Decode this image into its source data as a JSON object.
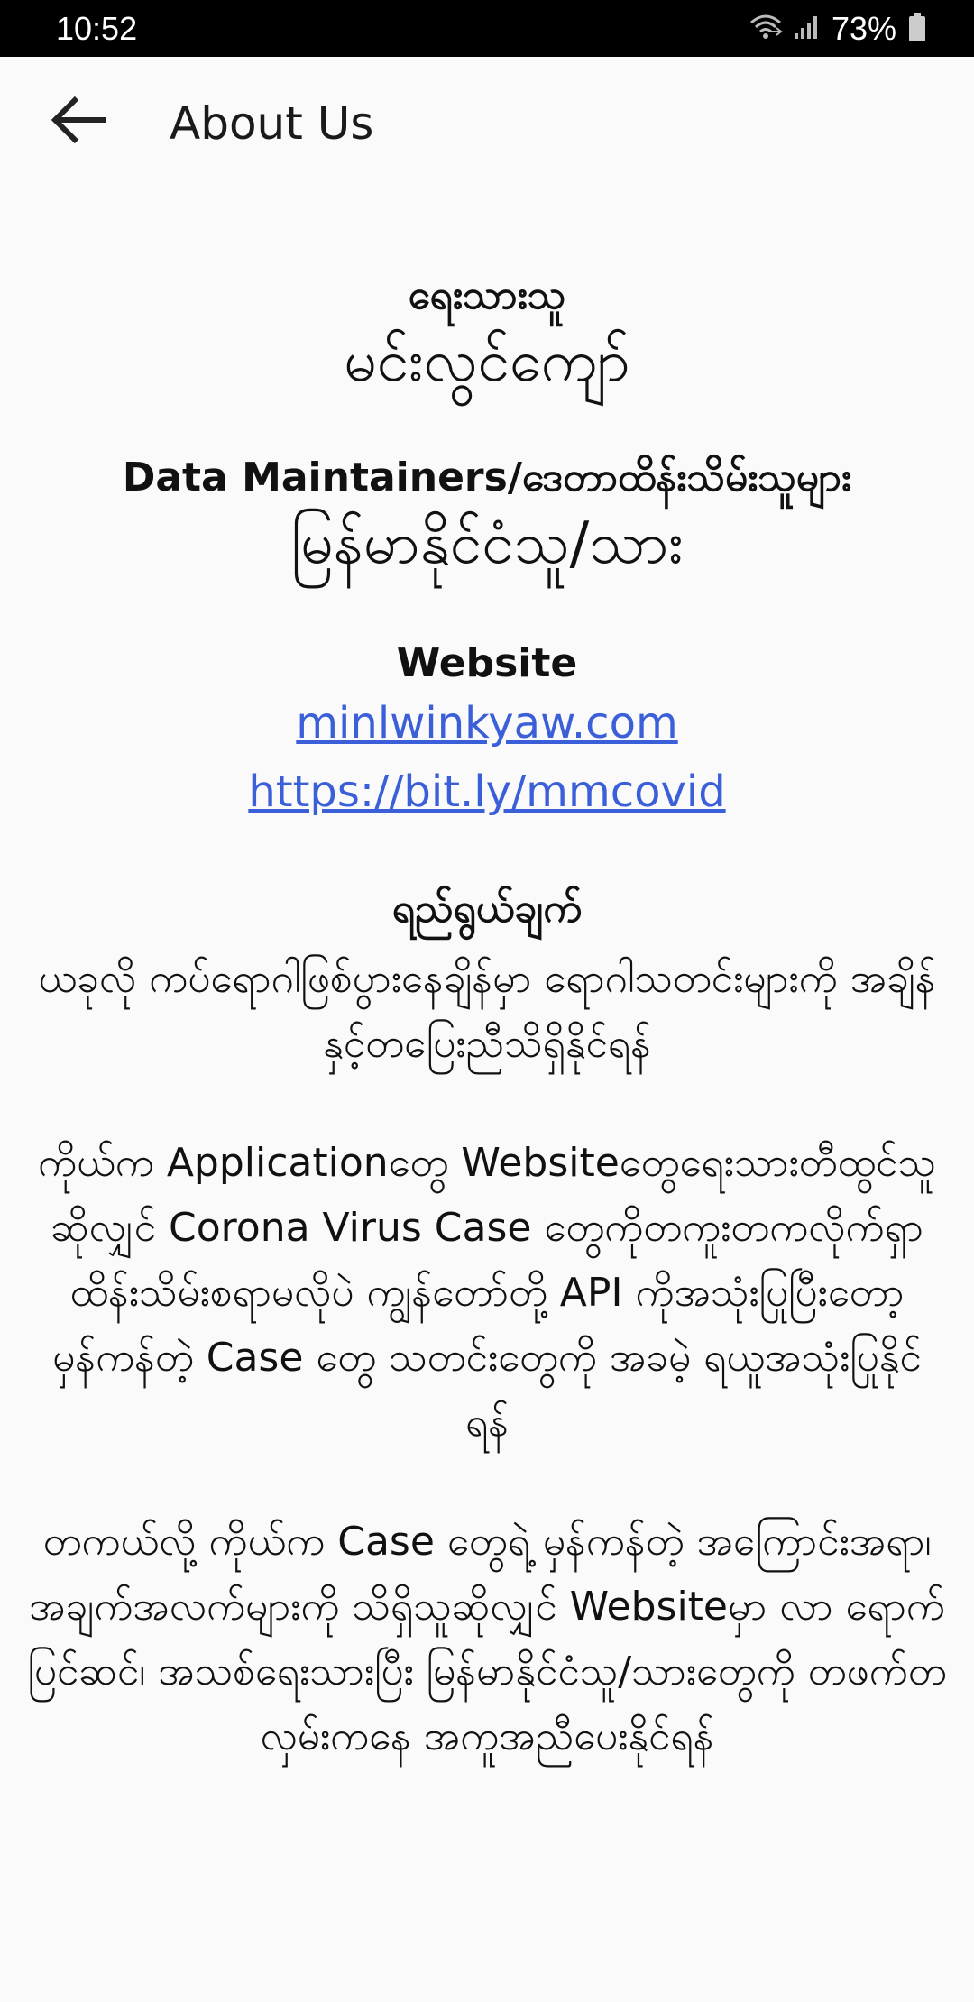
{
  "status_bar": {
    "time": "10:52",
    "battery_percent": "73%",
    "icons": [
      "wifi-icon",
      "signal-icon",
      "battery-icon"
    ]
  },
  "app_bar": {
    "title": "About Us",
    "back_icon": "arrow-left-icon"
  },
  "content": {
    "author_label": "ရေးသားသူ",
    "author_name": "မင်းလွင်ကျော်",
    "maintainers_label": "Data Maintainers/ဒေတာထိန်းသိမ်းသူများ",
    "maintainers_value": "မြန်မာနိုင်ငံသူ/သား",
    "website_label": "Website",
    "website_links": [
      "minlwinkyaw.com",
      "https://bit.ly/mmcovid"
    ],
    "purpose_label": "ရည်ရွယ်ချက်",
    "paragraphs": [
      "ယခုလို ကပ်ရောဂါဖြစ်ပွားနေချိန်မှာ ရောဂါသတင်းများကို အချိန်နှင့်တပြေးညီသိရှိနိုင်ရန်",
      "ကိုယ်က Applicationတွေ Websiteတွေရေးသားတီထွင်သူ ဆိုလျှင် Corona Virus Case တွေကိုတကူးတကလိုက်ရှာ ထိန်းသိမ်းစရာမလိုပဲ ကျွန်တော်တို့ API ကိုအသုံးပြုပြီးတော့ မှန်ကန်တဲ့ Case တွေ သတင်းတွေကို အခမဲ့ ရယူအသုံးပြုနိုင် ရန်",
      "တကယ်လို့ ကိုယ်က Case တွေရဲ့ မှန်ကန်တဲ့ အကြောင်းအရာ၊ အချက်အလက်များကို သိရှိသူဆိုလျှင် Websiteမှာ လာ ရောက်ပြင်ဆင်၊ အသစ်ရေးသားပြီး မြန်မာနိုင်ငံသူ/သားတွေကို တဖက်တလှမ်းကနေ အကူအညီပေးနိုင်ရန်"
    ]
  },
  "colors": {
    "status_bar_bg": "#000000",
    "page_bg": "#fafafa",
    "link": "#3b5fd8",
    "text": "#111111"
  }
}
